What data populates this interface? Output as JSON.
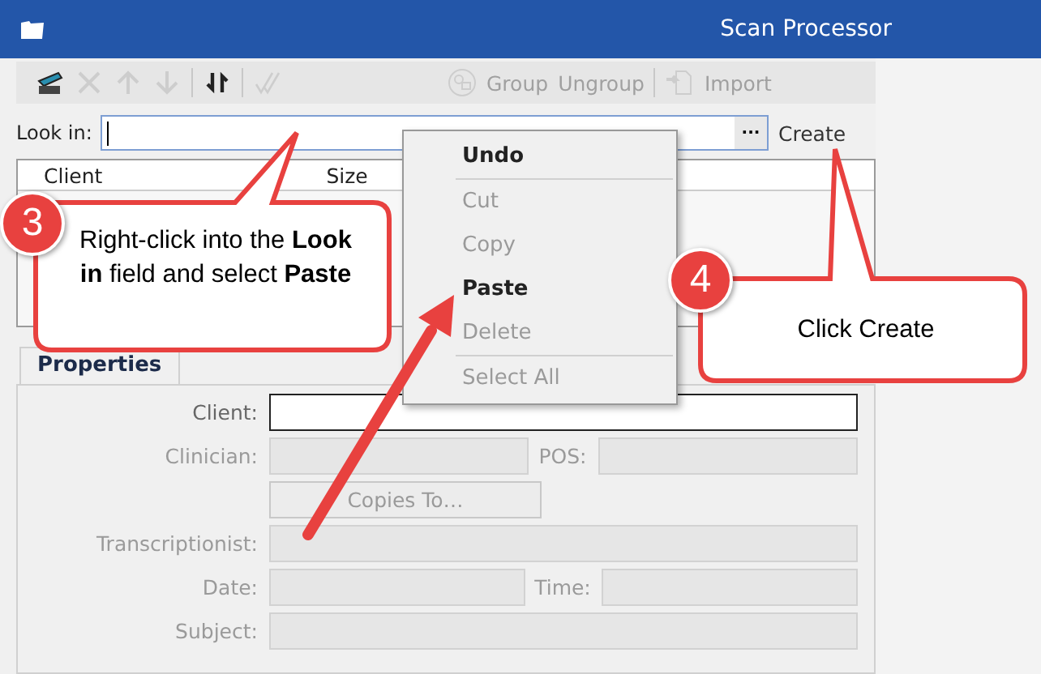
{
  "window": {
    "title": "Scan Processor"
  },
  "toolbar": {
    "icon_buttons": [
      {
        "disabled": false
      },
      {
        "disabled": true
      },
      {
        "disabled": true
      },
      {
        "disabled": true
      },
      {
        "disabled": false
      },
      {
        "disabled": true
      }
    ],
    "text_buttons": [
      {
        "label": "Group",
        "disabled": true
      },
      {
        "label": "Ungroup",
        "disabled": true
      },
      {
        "label": "Import",
        "disabled": true
      }
    ]
  },
  "look_in": {
    "label": "Look in:",
    "browse": "···",
    "create": "Create"
  },
  "list": {
    "columns": [
      "Client",
      "Size"
    ]
  },
  "properties": {
    "tab": "Properties",
    "rows": [
      [
        {
          "kind": "field",
          "label": "Client:",
          "disabled": false
        }
      ],
      [
        {
          "kind": "field",
          "label": "Clinician:",
          "disabled": true
        },
        {
          "kind": "field",
          "label": "POS:",
          "disabled": true
        }
      ],
      [
        {
          "kind": "button",
          "label": "Copies To…",
          "disabled": true
        }
      ],
      [
        {
          "kind": "field",
          "label": "Transcriptionist:",
          "disabled": true
        }
      ],
      [
        {
          "kind": "field",
          "label": "Date:",
          "disabled": true
        },
        {
          "kind": "field",
          "label": "Time:",
          "disabled": true
        }
      ],
      [
        {
          "kind": "field",
          "label": "Subject:",
          "disabled": true
        }
      ]
    ]
  },
  "context_menu": [
    {
      "kind": "item",
      "label": "Undo",
      "disabled": false,
      "bold": true
    },
    {
      "kind": "separator"
    },
    {
      "kind": "item",
      "label": "Cut",
      "disabled": true,
      "bold": false
    },
    {
      "kind": "item",
      "label": "Copy",
      "disabled": true,
      "bold": false
    },
    {
      "kind": "item",
      "label": "Paste",
      "disabled": false,
      "bold": true
    },
    {
      "kind": "item",
      "label": "Delete",
      "disabled": true,
      "bold": false
    },
    {
      "kind": "separator"
    },
    {
      "kind": "item",
      "label": "Select All",
      "disabled": true,
      "bold": false
    }
  ],
  "callouts": [
    {
      "number": "3",
      "text": "Right-click into the **Look in** field and select **Paste**"
    },
    {
      "number": "4",
      "text": "Click Create"
    }
  ]
}
